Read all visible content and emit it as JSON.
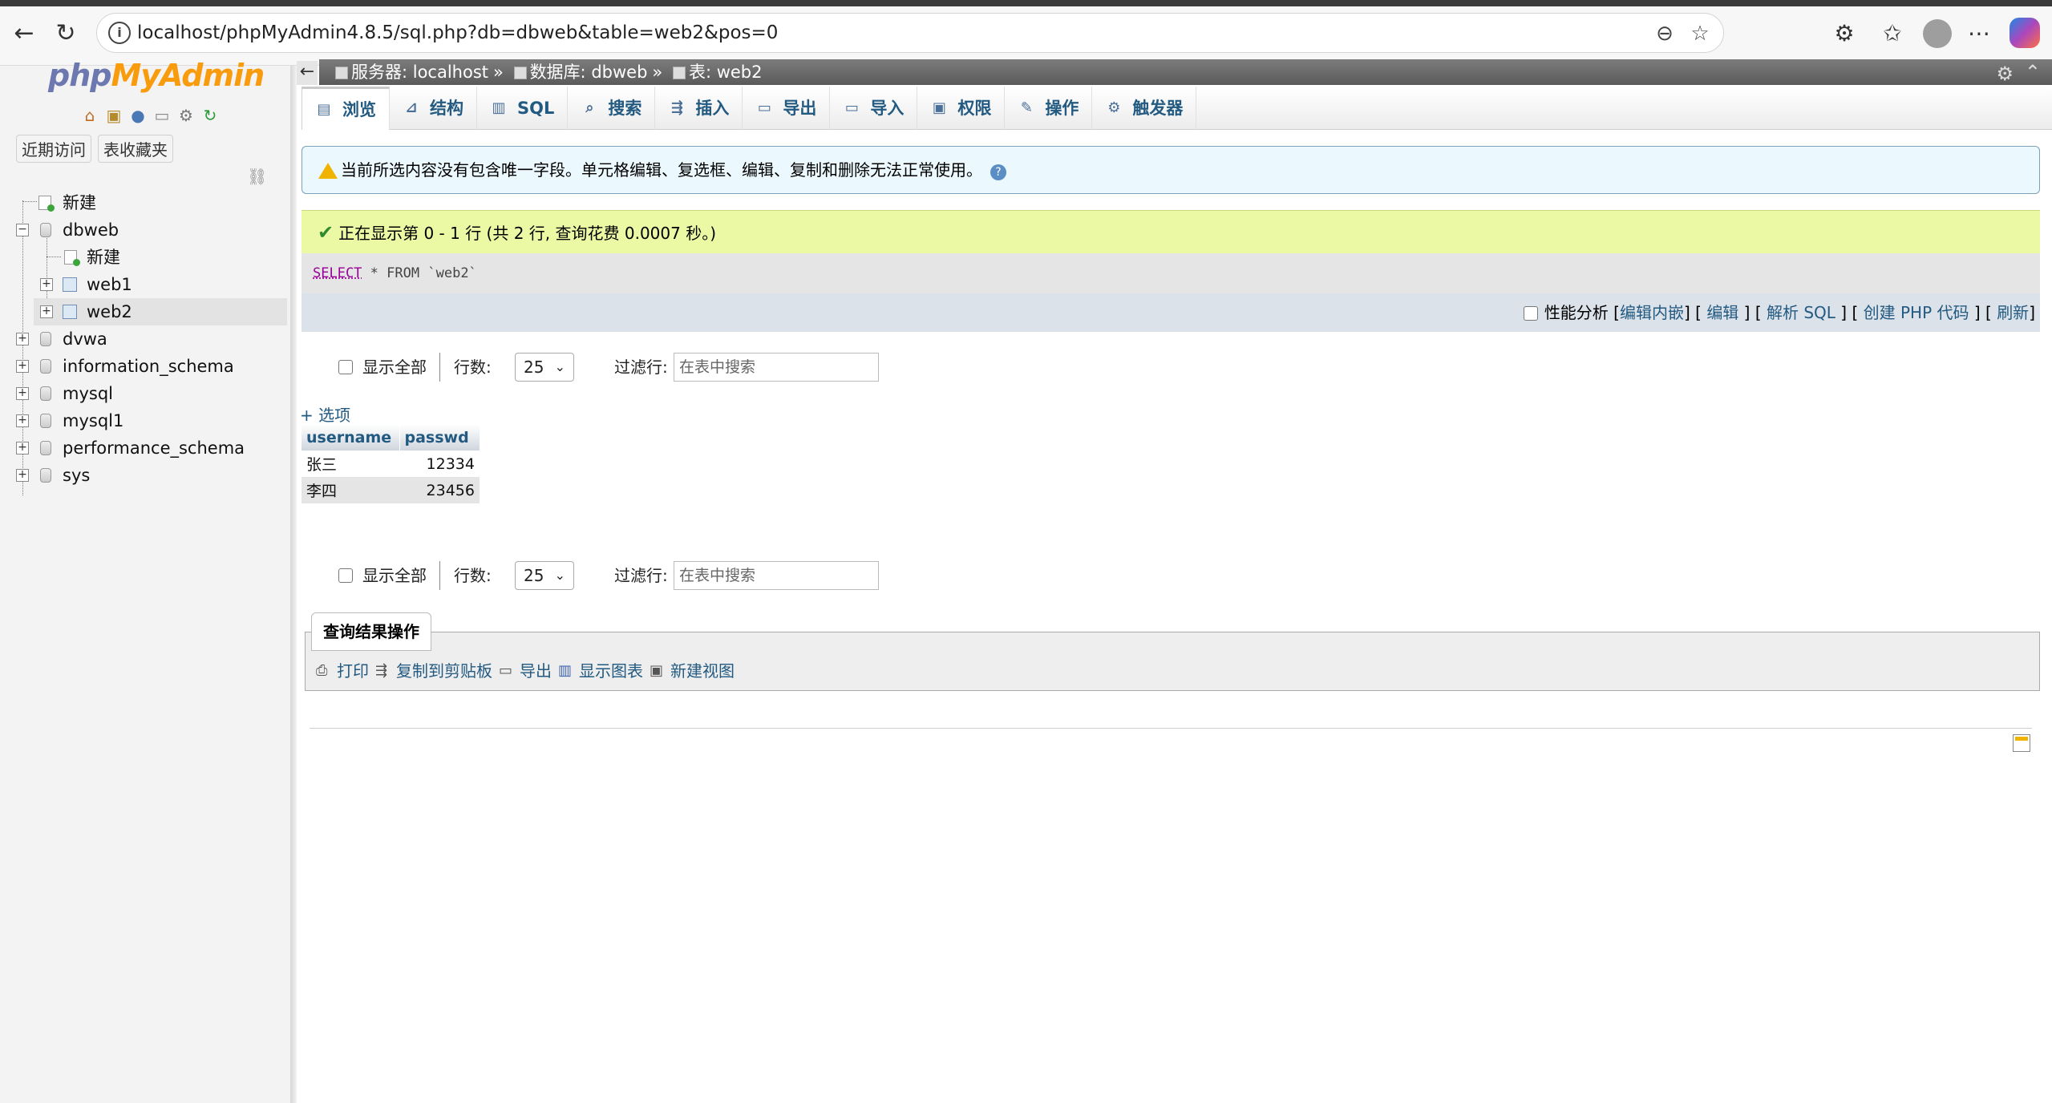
{
  "browser": {
    "url": "localhost/phpMyAdmin4.8.5/sql.php?db=dbweb&table=web2&pos=0"
  },
  "sidebar": {
    "logo_php": "php",
    "logo_myadmin": "MyAdmin",
    "recent_tab": "近期访问",
    "favorites_tab": "表收藏夹",
    "tree": [
      {
        "label": "新建"
      },
      {
        "label": "dbweb"
      },
      {
        "label": "新建"
      },
      {
        "label": "web1"
      },
      {
        "label": "web2"
      },
      {
        "label": "dvwa"
      },
      {
        "label": "information_schema"
      },
      {
        "label": "mysql"
      },
      {
        "label": "mysql1"
      },
      {
        "label": "performance_schema"
      },
      {
        "label": "sys"
      }
    ]
  },
  "breadcrumb": {
    "server": "服务器: localhost",
    "database": "数据库: dbweb",
    "table": "表: web2",
    "sep": "»"
  },
  "tabs": [
    {
      "label": "浏览",
      "icon": "browse-icon"
    },
    {
      "label": "结构",
      "icon": "structure-icon"
    },
    {
      "label": "SQL",
      "icon": "sql-icon"
    },
    {
      "label": "搜索",
      "icon": "search-icon"
    },
    {
      "label": "插入",
      "icon": "insert-icon"
    },
    {
      "label": "导出",
      "icon": "export-icon"
    },
    {
      "label": "导入",
      "icon": "import-icon"
    },
    {
      "label": "权限",
      "icon": "privileges-icon"
    },
    {
      "label": "操作",
      "icon": "operations-icon"
    },
    {
      "label": "触发器",
      "icon": "triggers-icon"
    }
  ],
  "notice": {
    "text": "当前所选内容没有包含唯一字段。单元格编辑、复选框、编辑、复制和删除无法正常使用。"
  },
  "success": {
    "text": "正在显示第 0 - 1 行 (共 2 行, 查询花费 0.0007 秒。)"
  },
  "sql": {
    "kw_select": "SELECT",
    "star": "*",
    "kw_from": "FROM",
    "table": "`web2`"
  },
  "sql_actions": {
    "profiling": "性能分析",
    "inline_edit": "编辑内嵌",
    "edit": "编辑",
    "explain": "解析 SQL",
    "create_php": "创建 PHP 代码",
    "refresh": "刷新"
  },
  "nav": {
    "show_all": "显示全部",
    "rows_label": "行数:",
    "rows_value": "25",
    "filter_label": "过滤行:",
    "filter_placeholder": "在表中搜索"
  },
  "options_link": "+ 选项",
  "results": {
    "columns": [
      "username",
      "passwd"
    ],
    "rows": [
      [
        "张三",
        "12334"
      ],
      [
        "李四",
        "23456"
      ]
    ]
  },
  "query_ops": {
    "legend": "查询结果操作",
    "print": "打印",
    "copy": "复制到剪贴板",
    "export": "导出",
    "chart": "显示图表",
    "view": "新建视图"
  }
}
